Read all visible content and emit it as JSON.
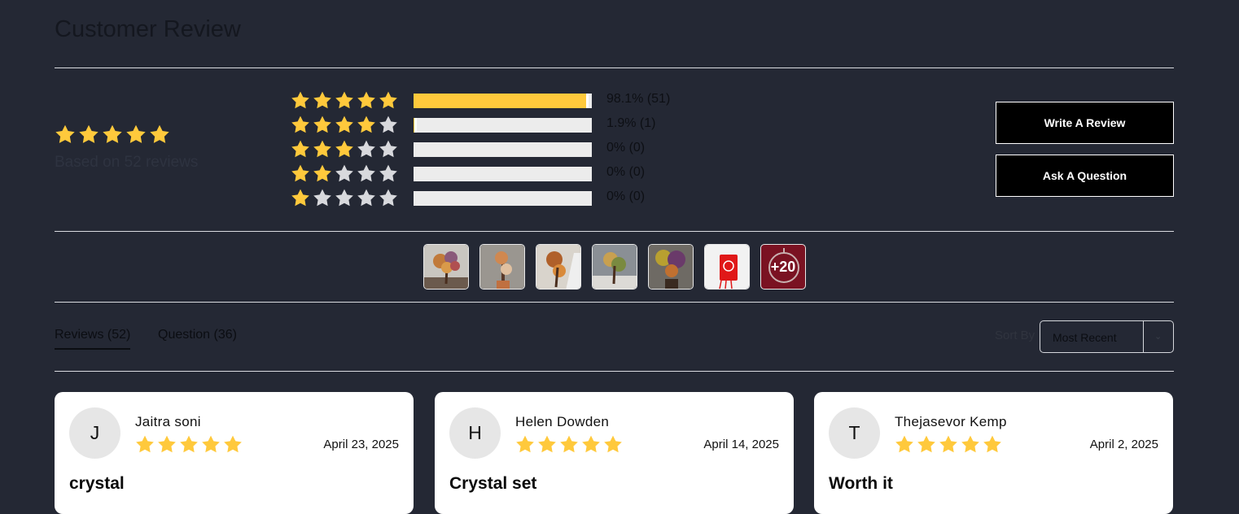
{
  "header": {
    "title": "Customer Review"
  },
  "summary": {
    "rating": 5,
    "stars_filled": 5,
    "text": "Based on 52 reviews"
  },
  "distribution": [
    {
      "stars": 5,
      "percent": 98.1,
      "label": "98.1% (51)"
    },
    {
      "stars": 4,
      "percent": 1.9,
      "label": "1.9% (1)"
    },
    {
      "stars": 3,
      "percent": 0,
      "label": "0% (0)"
    },
    {
      "stars": 2,
      "percent": 0,
      "label": "0% (0)"
    },
    {
      "stars": 1,
      "percent": 0,
      "label": "0% (0)"
    }
  ],
  "actions": {
    "write_review": "Write A Review",
    "ask_question": "Ask A Question"
  },
  "photos": {
    "more_label": "+20"
  },
  "tabs": [
    {
      "label": "Reviews (52)",
      "active": true
    },
    {
      "label": "Question (36)",
      "active": false
    }
  ],
  "sort": {
    "label": "Sort By",
    "selected": "Most Recent"
  },
  "reviews": [
    {
      "initial": "J",
      "author": "Jaitra soni",
      "rating": 5,
      "date": "April 23, 2025",
      "title": "crystal"
    },
    {
      "initial": "H",
      "author": "Helen Dowden",
      "rating": 5,
      "date": "April 14, 2025",
      "title": "Crystal set"
    },
    {
      "initial": "T",
      "author": "Thejasevor Kemp",
      "rating": 5,
      "date": "April 2, 2025",
      "title": "Worth it"
    }
  ],
  "colors": {
    "background": "#242834",
    "star_filled": "#ffc93c",
    "star_empty": "#d8d9dd",
    "bar_track": "#ececec",
    "button_bg": "#000000"
  }
}
